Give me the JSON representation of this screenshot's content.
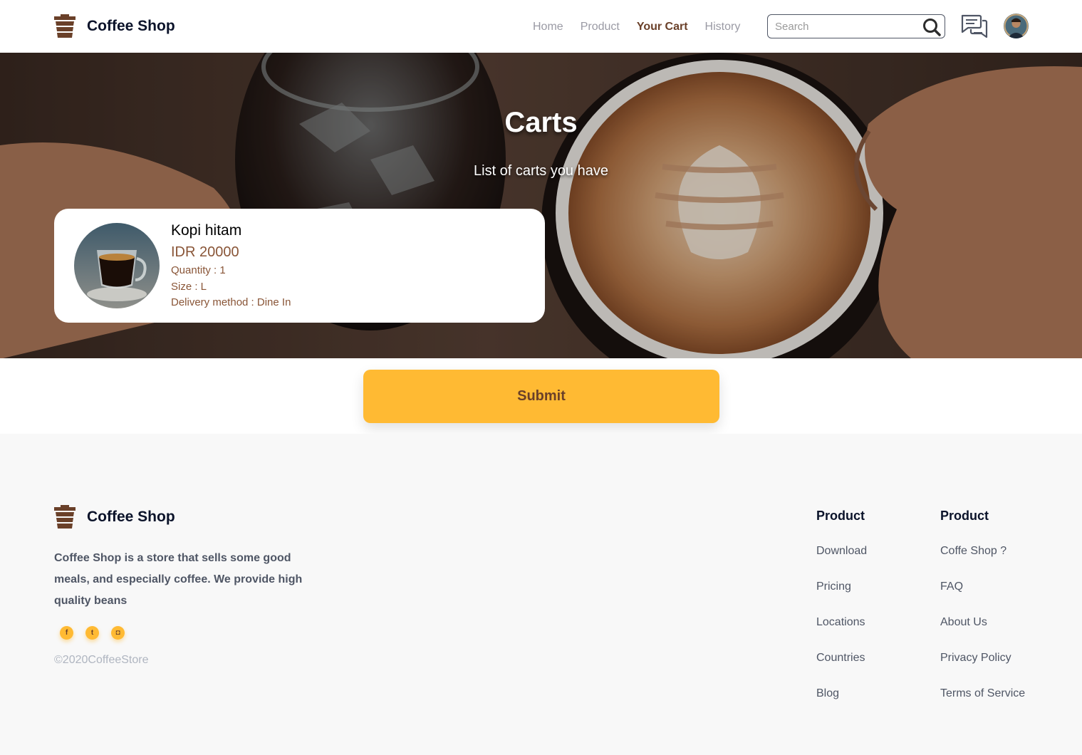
{
  "brand": {
    "name": "Coffee Shop"
  },
  "nav": {
    "items": [
      {
        "label": "Home",
        "active": false
      },
      {
        "label": "Product",
        "active": false
      },
      {
        "label": "Your Cart",
        "active": true
      },
      {
        "label": "History",
        "active": false
      }
    ]
  },
  "search": {
    "placeholder": "Search",
    "value": ""
  },
  "hero": {
    "title": "Carts",
    "subtitle": "List of carts you have"
  },
  "cart": {
    "items": [
      {
        "name": "Kopi hitam",
        "price": "IDR 20000",
        "quantity": "Quantity : 1",
        "size": "Size : L",
        "delivery": "Delivery method : Dine In"
      }
    ]
  },
  "submit": {
    "label": "Submit"
  },
  "footer": {
    "brand": "Coffee Shop",
    "description": "Coffee Shop is a store that sells some good meals, and especially coffee. We provide high quality beans",
    "socials": [
      {
        "icon": "facebook-icon",
        "glyph": "f"
      },
      {
        "icon": "twitter-icon",
        "glyph": "t"
      },
      {
        "icon": "instagram-icon",
        "glyph": "◘"
      }
    ],
    "copyright": "©2020CoffeeStore",
    "columns": [
      {
        "title": "Product",
        "links": [
          "Download",
          "Pricing",
          "Locations",
          "Countries",
          "Blog"
        ]
      },
      {
        "title": "Product",
        "links": [
          "Coffe Shop ?",
          "FAQ",
          "About Us",
          "Privacy Policy",
          "Terms of Service"
        ]
      }
    ]
  },
  "colors": {
    "accent": "#ffba33",
    "brown": "#6a4029",
    "price": "#895537",
    "muted": "#9a9aa4"
  }
}
